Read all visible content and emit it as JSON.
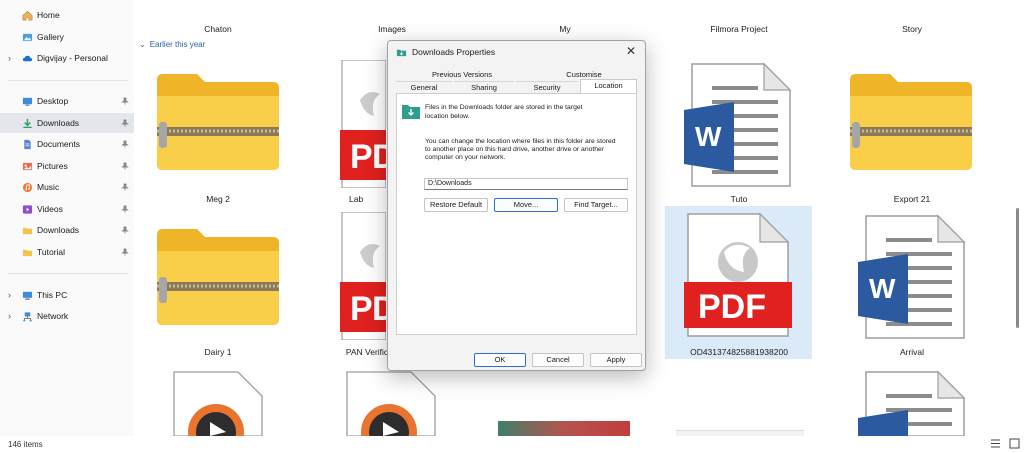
{
  "sidebar": {
    "items": [
      {
        "label": "Home",
        "icon": "home-icon"
      },
      {
        "label": "Gallery",
        "icon": "gallery-icon"
      },
      {
        "label": "Digvijay - Personal",
        "icon": "cloud-icon"
      },
      {
        "label": "Desktop",
        "icon": "desktop-icon"
      },
      {
        "label": "Downloads",
        "icon": "download-icon"
      },
      {
        "label": "Documents",
        "icon": "document-icon"
      },
      {
        "label": "Pictures",
        "icon": "pictures-icon"
      },
      {
        "label": "Music",
        "icon": "music-icon"
      },
      {
        "label": "Videos",
        "icon": "videos-icon"
      },
      {
        "label": "Downloads",
        "icon": "folder-icon"
      },
      {
        "label": "Tutorial",
        "icon": "folder-icon"
      },
      {
        "label": "This PC",
        "icon": "computer-icon"
      },
      {
        "label": "Network",
        "icon": "network-icon"
      }
    ]
  },
  "content": {
    "group_header": "Earlier this year",
    "files": [
      {
        "name": "Chaton",
        "type": "zip"
      },
      {
        "name": "Images",
        "type": "pdf"
      },
      {
        "name": "My",
        "type": "hidden"
      },
      {
        "name": "Filmora Project",
        "type": "word"
      },
      {
        "name": "Story",
        "type": "zip"
      },
      {
        "name": "Meg 2",
        "type": "zip"
      },
      {
        "name": "Lab",
        "type": "pdf"
      },
      {
        "name": "Tuto",
        "type": "pdf-logo"
      },
      {
        "name": "Export 21",
        "type": "word"
      },
      {
        "name": "Dairy 1",
        "type": "media"
      },
      {
        "name": "PAN Verific",
        "type": "media"
      },
      {
        "name": "OD431374825881938200",
        "type": "pdf-selected"
      },
      {
        "name": "Arrival",
        "type": "word"
      }
    ],
    "pdf_text": "PDF",
    "word_letter": "W"
  },
  "status": {
    "item_count": "146 items"
  },
  "dialog": {
    "title": "Downloads Properties",
    "tabs": [
      "Previous Versions",
      "Customise",
      "General",
      "Sharing",
      "Security",
      "Location"
    ],
    "active_tab": "Location",
    "info_text_1": "Files in the Downloads folder are stored in the target",
    "info_text_2": "location below.",
    "desc_1": "You can change the location where files in this folder are stored",
    "desc_2": "to another place on this hard drive, another drive or another",
    "desc_3": "computer on your network.",
    "path_value": "D:\\Downloads",
    "buttons": {
      "restore": "Restore Default",
      "move": "Move...",
      "find": "Find Target..."
    },
    "footer": {
      "ok": "OK",
      "cancel": "Cancel",
      "apply": "Apply"
    }
  },
  "colors": {
    "accent": "#2b6fd6",
    "pdf_red": "#e0211f",
    "word_blue": "#2c5aa0",
    "zip_yellow": "#f5c843"
  }
}
